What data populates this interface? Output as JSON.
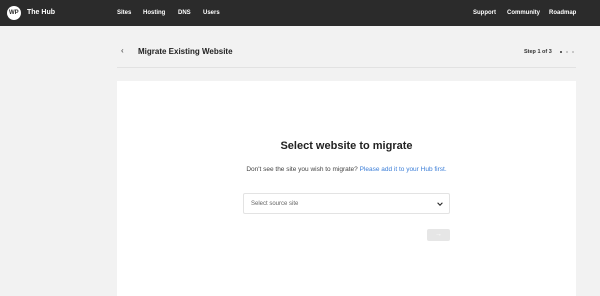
{
  "topbar": {
    "logo_text": "WP",
    "brand": "The Hub",
    "nav": [
      "Sites",
      "Hosting",
      "DNS",
      "Users"
    ],
    "right_nav": [
      "Support",
      "Community",
      "Roadmap"
    ]
  },
  "header": {
    "back_icon": "‹",
    "title": "Migrate Existing Website",
    "step": "Step 1 of 3"
  },
  "card": {
    "title": "Select website to migrate",
    "hint": "Don't see the site you wish to migrate?",
    "hint_link": "Please add it to your Hub first.",
    "select_value": "Select source site",
    "next_icon": "→"
  }
}
